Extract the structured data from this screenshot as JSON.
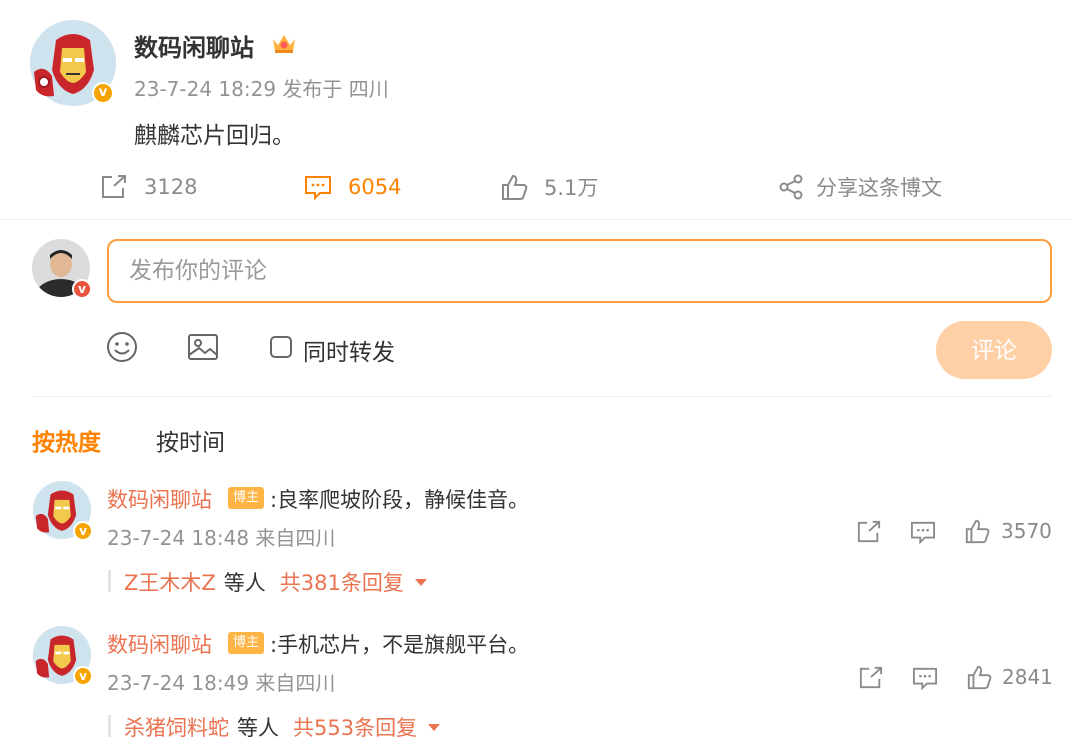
{
  "post": {
    "author": "数码闲聊站",
    "meta": "23-7-24 18:29 发布于 四川",
    "text": "麒麟芯片回归。",
    "badge_icon": "verified-v-icon",
    "crown_icon": "crown-icon",
    "actions": {
      "repost_count": "3128",
      "comment_count": "6054",
      "like_count": "5.1万",
      "share_label": "分享这条博文"
    }
  },
  "composer": {
    "placeholder": "发布你的评论",
    "repost_label": "同时转发",
    "submit_label": "评论"
  },
  "sort": {
    "hot": "按热度",
    "time": "按时间"
  },
  "comments": [
    {
      "author": "数码闲聊站",
      "tag": "博主",
      "text": ":良率爬坡阶段，静候佳音。",
      "meta": "23-7-24 18:48 来自四川",
      "likes": "3570",
      "reply_users": "Z王木木Z",
      "reply_etc": "等人",
      "reply_total": "共381条回复"
    },
    {
      "author": "数码闲聊站",
      "tag": "博主",
      "text": ":手机芯片，不是旗舰平台。",
      "meta": "23-7-24 18:49 来自四川",
      "likes": "2841",
      "reply_users": "杀猪饲料蛇",
      "reply_etc": "等人",
      "reply_total": "共553条回复"
    }
  ],
  "colors": {
    "accent": "#ff8200",
    "name_link": "#eb7350",
    "input_border": "#ff9d3b",
    "submit_disabled": "#ffcfa6",
    "verified": "#f7a400"
  }
}
